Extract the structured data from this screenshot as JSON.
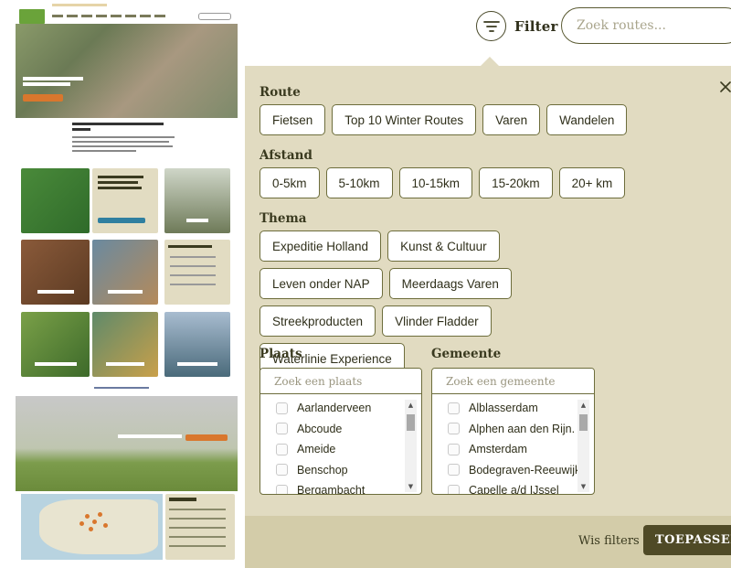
{
  "header": {
    "filter_label": "Filter",
    "search_placeholder": "Zoek routes..."
  },
  "sections": {
    "route": {
      "title": "Route",
      "options": [
        "Fietsen",
        "Top 10 Winter Routes",
        "Varen",
        "Wandelen"
      ]
    },
    "afstand": {
      "title": "Afstand",
      "options": [
        "0-5km",
        "5-10km",
        "10-15km",
        "15-20km",
        "20+ km"
      ]
    },
    "thema": {
      "title": "Thema",
      "options": [
        "Expeditie Holland",
        "Kunst & Cultuur",
        "Leven onder NAP",
        "Meerdaags Varen",
        "Streekproducten",
        "Vlinder Fladder",
        "Waterlinie Experience"
      ]
    },
    "plaats": {
      "title": "Plaats",
      "search_placeholder": "Zoek een plaats",
      "items": [
        "Aarlanderveen",
        "Abcoude",
        "Ameide",
        "Benschop",
        "Bergambacht"
      ]
    },
    "gemeente": {
      "title": "Gemeente",
      "search_placeholder": "Zoek een gemeente",
      "items": [
        "Alblasserdam",
        "Alphen aan den Rijn.",
        "Amsterdam",
        "Bodegraven-Reeuwijk",
        "Capelle a/d IJssel"
      ]
    }
  },
  "footer": {
    "clear_label": "Wis filters",
    "apply_label": "TOEPASSEN"
  },
  "colors": {
    "panel_bg": "#e1dbc1",
    "footer_bg": "#d3cca9",
    "apply_bg": "#4f4a26",
    "border": "#6d6d3c"
  }
}
